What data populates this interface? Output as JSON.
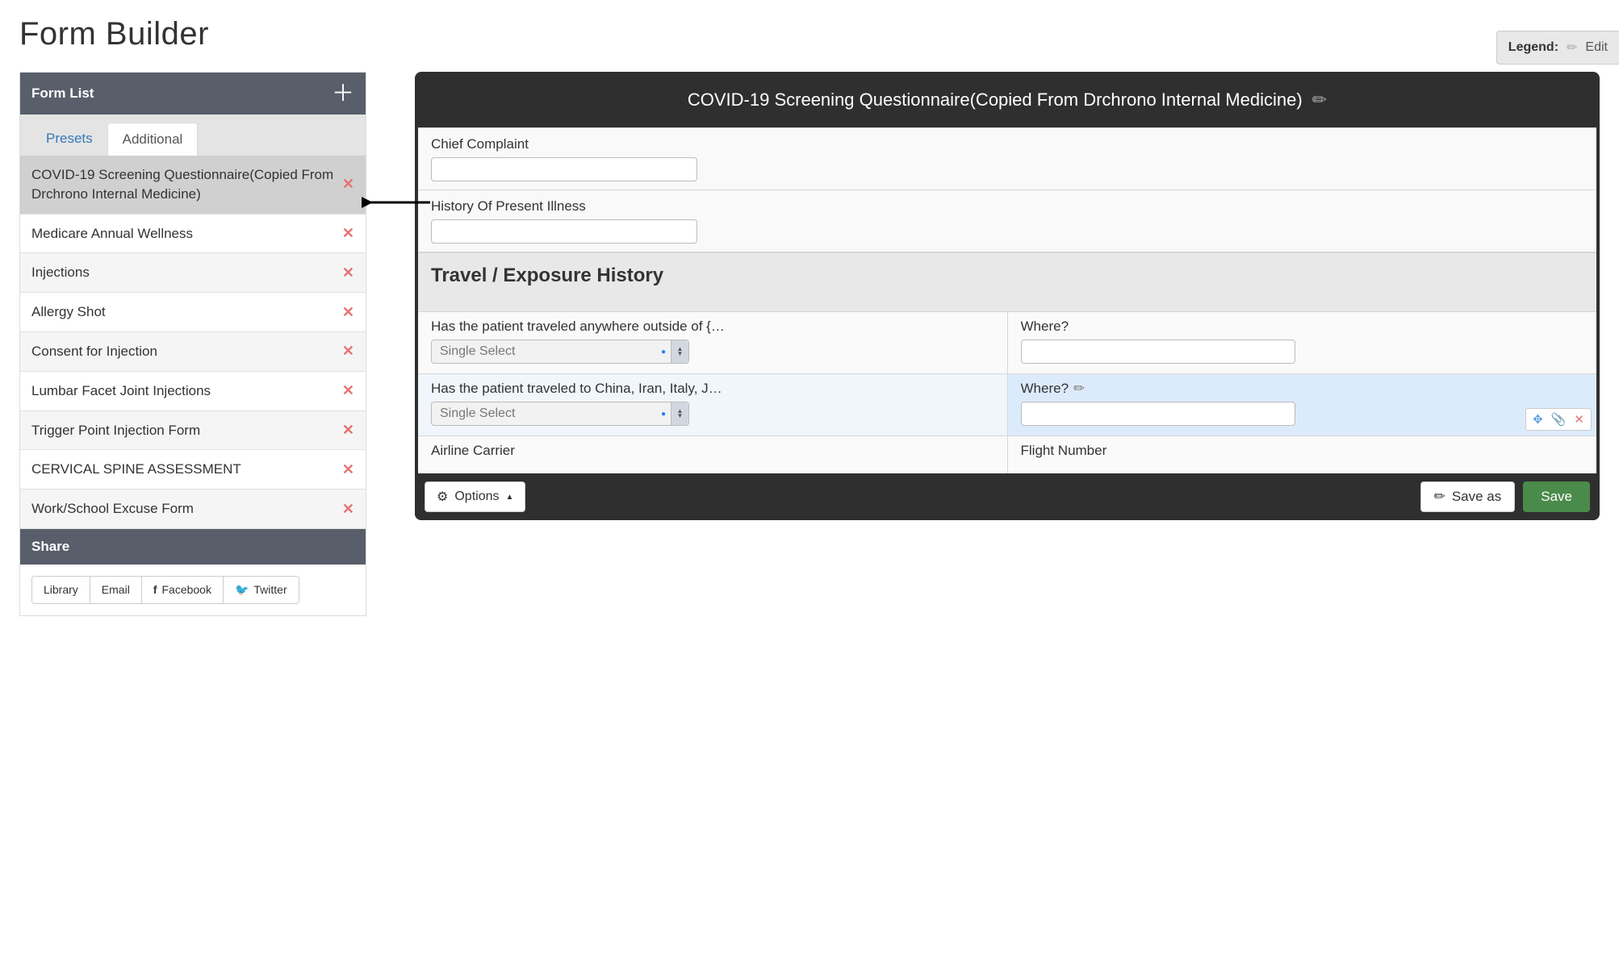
{
  "page": {
    "title": "Form Builder"
  },
  "legend": {
    "label": "Legend:",
    "edit": "Edit"
  },
  "sidebar": {
    "header": "Form List",
    "tabs": {
      "presets": "Presets",
      "additional": "Additional"
    },
    "items": [
      {
        "label": "COVID-19 Screening Questionnaire(Copied From Drchrono Internal Medicine)",
        "selected": true
      },
      {
        "label": "Medicare Annual Wellness"
      },
      {
        "label": "Injections"
      },
      {
        "label": "Allergy Shot"
      },
      {
        "label": "Consent for Injection"
      },
      {
        "label": "Lumbar Facet Joint Injections"
      },
      {
        "label": "Trigger Point Injection Form"
      },
      {
        "label": "CERVICAL SPINE ASSESSMENT"
      },
      {
        "label": "Work/School Excuse Form"
      }
    ],
    "share": {
      "title": "Share",
      "buttons": {
        "library": "Library",
        "email": "Email",
        "facebook": "Facebook",
        "twitter": "Twitter"
      }
    }
  },
  "canvas": {
    "title": "COVID-19 Screening Questionnaire(Copied From Drchrono Internal Medicine)",
    "fields": {
      "chief_complaint": "Chief Complaint",
      "hpi": "History Of Present Illness"
    },
    "section1": {
      "title": "Travel / Exposure History"
    },
    "rows": [
      {
        "q": "Has the patient traveled anywhere outside of {…",
        "select": "Single Select",
        "r": "Where?"
      },
      {
        "q": "Has the patient traveled to China, Iran, Italy, J…",
        "select": "Single Select",
        "r": "Where?",
        "highlighted": true
      },
      {
        "q": "Airline Carrier",
        "r": "Flight Number",
        "no_select": true
      }
    ],
    "footer": {
      "options": "Options",
      "saveas": "Save as",
      "save": "Save"
    }
  }
}
